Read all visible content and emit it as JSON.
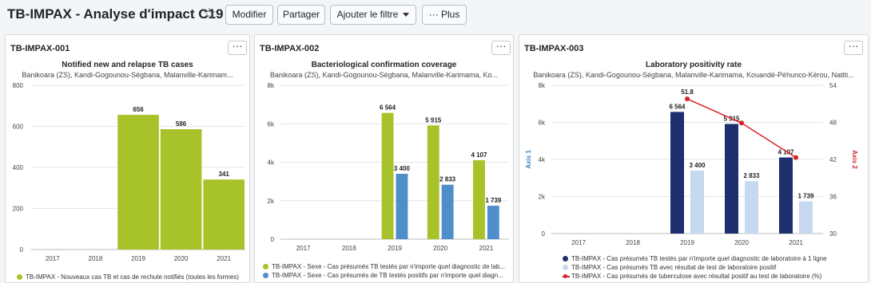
{
  "header": {
    "title": "TB-IMPAX - Analyse d'impact C19",
    "star_glyph": "☆",
    "modify_label": "Modifier",
    "share_label": "Partager",
    "add_filter_label": "Ajouter le filtre",
    "more_label": "··· Plus"
  },
  "cards": [
    {
      "id": "TB-IMPAX-001",
      "menu_glyph": "···",
      "title": "Notified new and relapse TB cases",
      "subtitle": "Banikoara (ZS), Kandi-Gogounou-Ségbana, Malanville-Karimam...",
      "legend": [
        "TB-IMPAX - Nouveaux cas TB et cas de rechute notifiés (toutes les formes)"
      ]
    },
    {
      "id": "TB-IMPAX-002",
      "menu_glyph": "···",
      "title": "Bacteriological confirmation coverage",
      "subtitle": "Banikoara (ZS), Kandi-Gogounou-Ségbana, Malanville-Karimama, Ko...",
      "legend": [
        "TB-IMPAX - Sexe - Cas présumés TB testés par n'importe quel diagnostic de lab...",
        "TB-IMPAX - Sexe - Cas présumés de TB testés positifs par n'importe quel diagn..."
      ]
    },
    {
      "id": "TB-IMPAX-003",
      "menu_glyph": "···",
      "title": "Laboratory positivity rate",
      "subtitle": "Banikoara (ZS), Kandi-Gogounou-Ségbana, Malanville-Karimama, Kouandé-Péhunco-Kérou, Natiti...",
      "legend": [
        "TB-IMPAX - Cas présumés TB testés par n'importe quel diagnostic de laboratoire à 1 ligne",
        "TB-IMPAX - Cas présumés TB avec résultat de test de laboratoire positif",
        "TB-IMPAX - Cas présumés de tuberculose avec résultat positif au test de laboratoire (%)"
      ]
    }
  ],
  "chart_data": [
    {
      "type": "bar",
      "categories": [
        "2017",
        "2018",
        "2019",
        "2020",
        "2021"
      ],
      "series": [
        {
          "name": "TB-IMPAX - Nouveaux cas TB et cas de rechute notifiés (toutes les formes)",
          "values": [
            null,
            null,
            656,
            586,
            341
          ],
          "color": "#a8c22a"
        }
      ],
      "value_labels": [
        "",
        "",
        "656",
        "586",
        "341"
      ],
      "ylim": [
        0,
        800
      ],
      "yticks": [
        0,
        200,
        400,
        600,
        800
      ],
      "ytick_labels": [
        "0",
        "200",
        "400",
        "600",
        "800"
      ],
      "bar_style": "histogram",
      "grid": true,
      "legend": "bottom"
    },
    {
      "type": "bar",
      "categories": [
        "2017",
        "2018",
        "2019",
        "2020",
        "2021"
      ],
      "series": [
        {
          "name": "TB-IMPAX - Sexe - Cas présumés TB testés par n'importe quel diagnostic de lab...",
          "values": [
            null,
            null,
            6564,
            5915,
            4107
          ],
          "labels": [
            "",
            "",
            "6 564",
            "5 915",
            "4 107"
          ],
          "color": "#a8c22a"
        },
        {
          "name": "TB-IMPAX - Sexe - Cas présumés de TB testés positifs par n'importe quel diagn...",
          "values": [
            null,
            null,
            3400,
            2833,
            1739
          ],
          "labels": [
            "",
            "",
            "3 400",
            "2 833",
            "1 739"
          ],
          "color": "#4f8ec9"
        }
      ],
      "ylim": [
        0,
        8000
      ],
      "yticks": [
        0,
        2000,
        4000,
        6000,
        8000
      ],
      "ytick_labels": [
        "0",
        "2k",
        "4k",
        "6k",
        "8k"
      ],
      "grid": true,
      "legend": "bottom"
    },
    {
      "type": "bar",
      "categories": [
        "2017",
        "2018",
        "2019",
        "2020",
        "2021"
      ],
      "series": [
        {
          "name": "TB-IMPAX - Cas présumés TB testés par n'importe quel diagnostic de laboratoire à 1 ligne",
          "values": [
            null,
            null,
            6564,
            5915,
            4107
          ],
          "labels": [
            "",
            "",
            "6 564",
            "5 915",
            "4 107"
          ],
          "color": "#1d2f6f",
          "axis": 1
        },
        {
          "name": "TB-IMPAX - Cas présumés TB avec résultat de test de laboratoire positif",
          "values": [
            null,
            null,
            3400,
            2833,
            1739
          ],
          "labels": [
            "",
            "",
            "3 400",
            "2 833",
            "1 739"
          ],
          "color": "#c6d9f0",
          "axis": 1
        },
        {
          "name": "TB-IMPAX - Cas présumés de tuberculose avec résultat positif au test de laboratoire (%)",
          "type": "line",
          "values": [
            null,
            null,
            51.8,
            47.9,
            42.3
          ],
          "labels": [
            "",
            "",
            "51.8",
            "",
            ""
          ],
          "color": "#d6202a",
          "axis": 2
        }
      ],
      "ylabel": "Axis 1",
      "y2label": "Axis 2",
      "ylim": [
        0,
        8000
      ],
      "yticks": [
        0,
        2000,
        4000,
        6000,
        8000
      ],
      "ytick_labels": [
        "0",
        "2k",
        "4k",
        "6k",
        "8k"
      ],
      "y2lim": [
        30,
        54
      ],
      "y2ticks": [
        30,
        36,
        42,
        48,
        54
      ],
      "y2tick_labels": [
        "30",
        "36",
        "42",
        "48",
        "54"
      ],
      "grid": true,
      "legend": "bottom"
    }
  ]
}
